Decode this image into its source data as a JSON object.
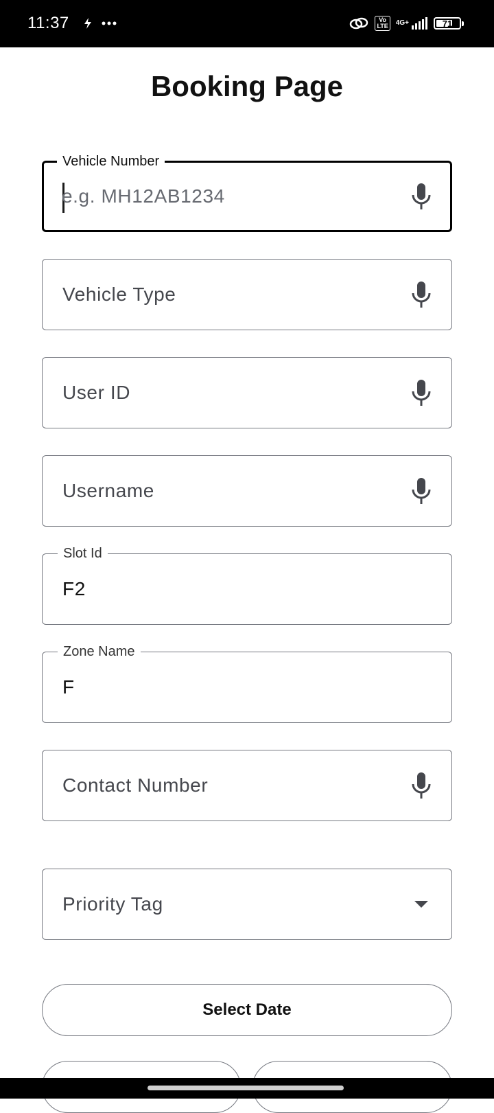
{
  "status_bar": {
    "time": "11:37",
    "volte_top": "Vo",
    "volte_bottom": "LTE",
    "network": "4G+",
    "battery": "71",
    "battery_level": 0.71
  },
  "page": {
    "title": "Booking Page"
  },
  "fields": {
    "vehicle_number": {
      "label": "Vehicle Number",
      "placeholder": "e.g. MH12AB1234"
    },
    "vehicle_type": {
      "label": "Vehicle Type"
    },
    "user_id": {
      "label": "User ID"
    },
    "username": {
      "label": "Username"
    },
    "slot_id": {
      "label": "Slot Id",
      "value": "F2"
    },
    "zone_name": {
      "label": "Zone Name",
      "value": "F"
    },
    "contact_number": {
      "label": "Contact Number"
    },
    "priority_tag": {
      "label": "Priority Tag"
    }
  },
  "buttons": {
    "select_date": "Select Date"
  },
  "icons": {
    "mic": "mic-icon",
    "dropdown": "arrow-drop-down-icon"
  }
}
